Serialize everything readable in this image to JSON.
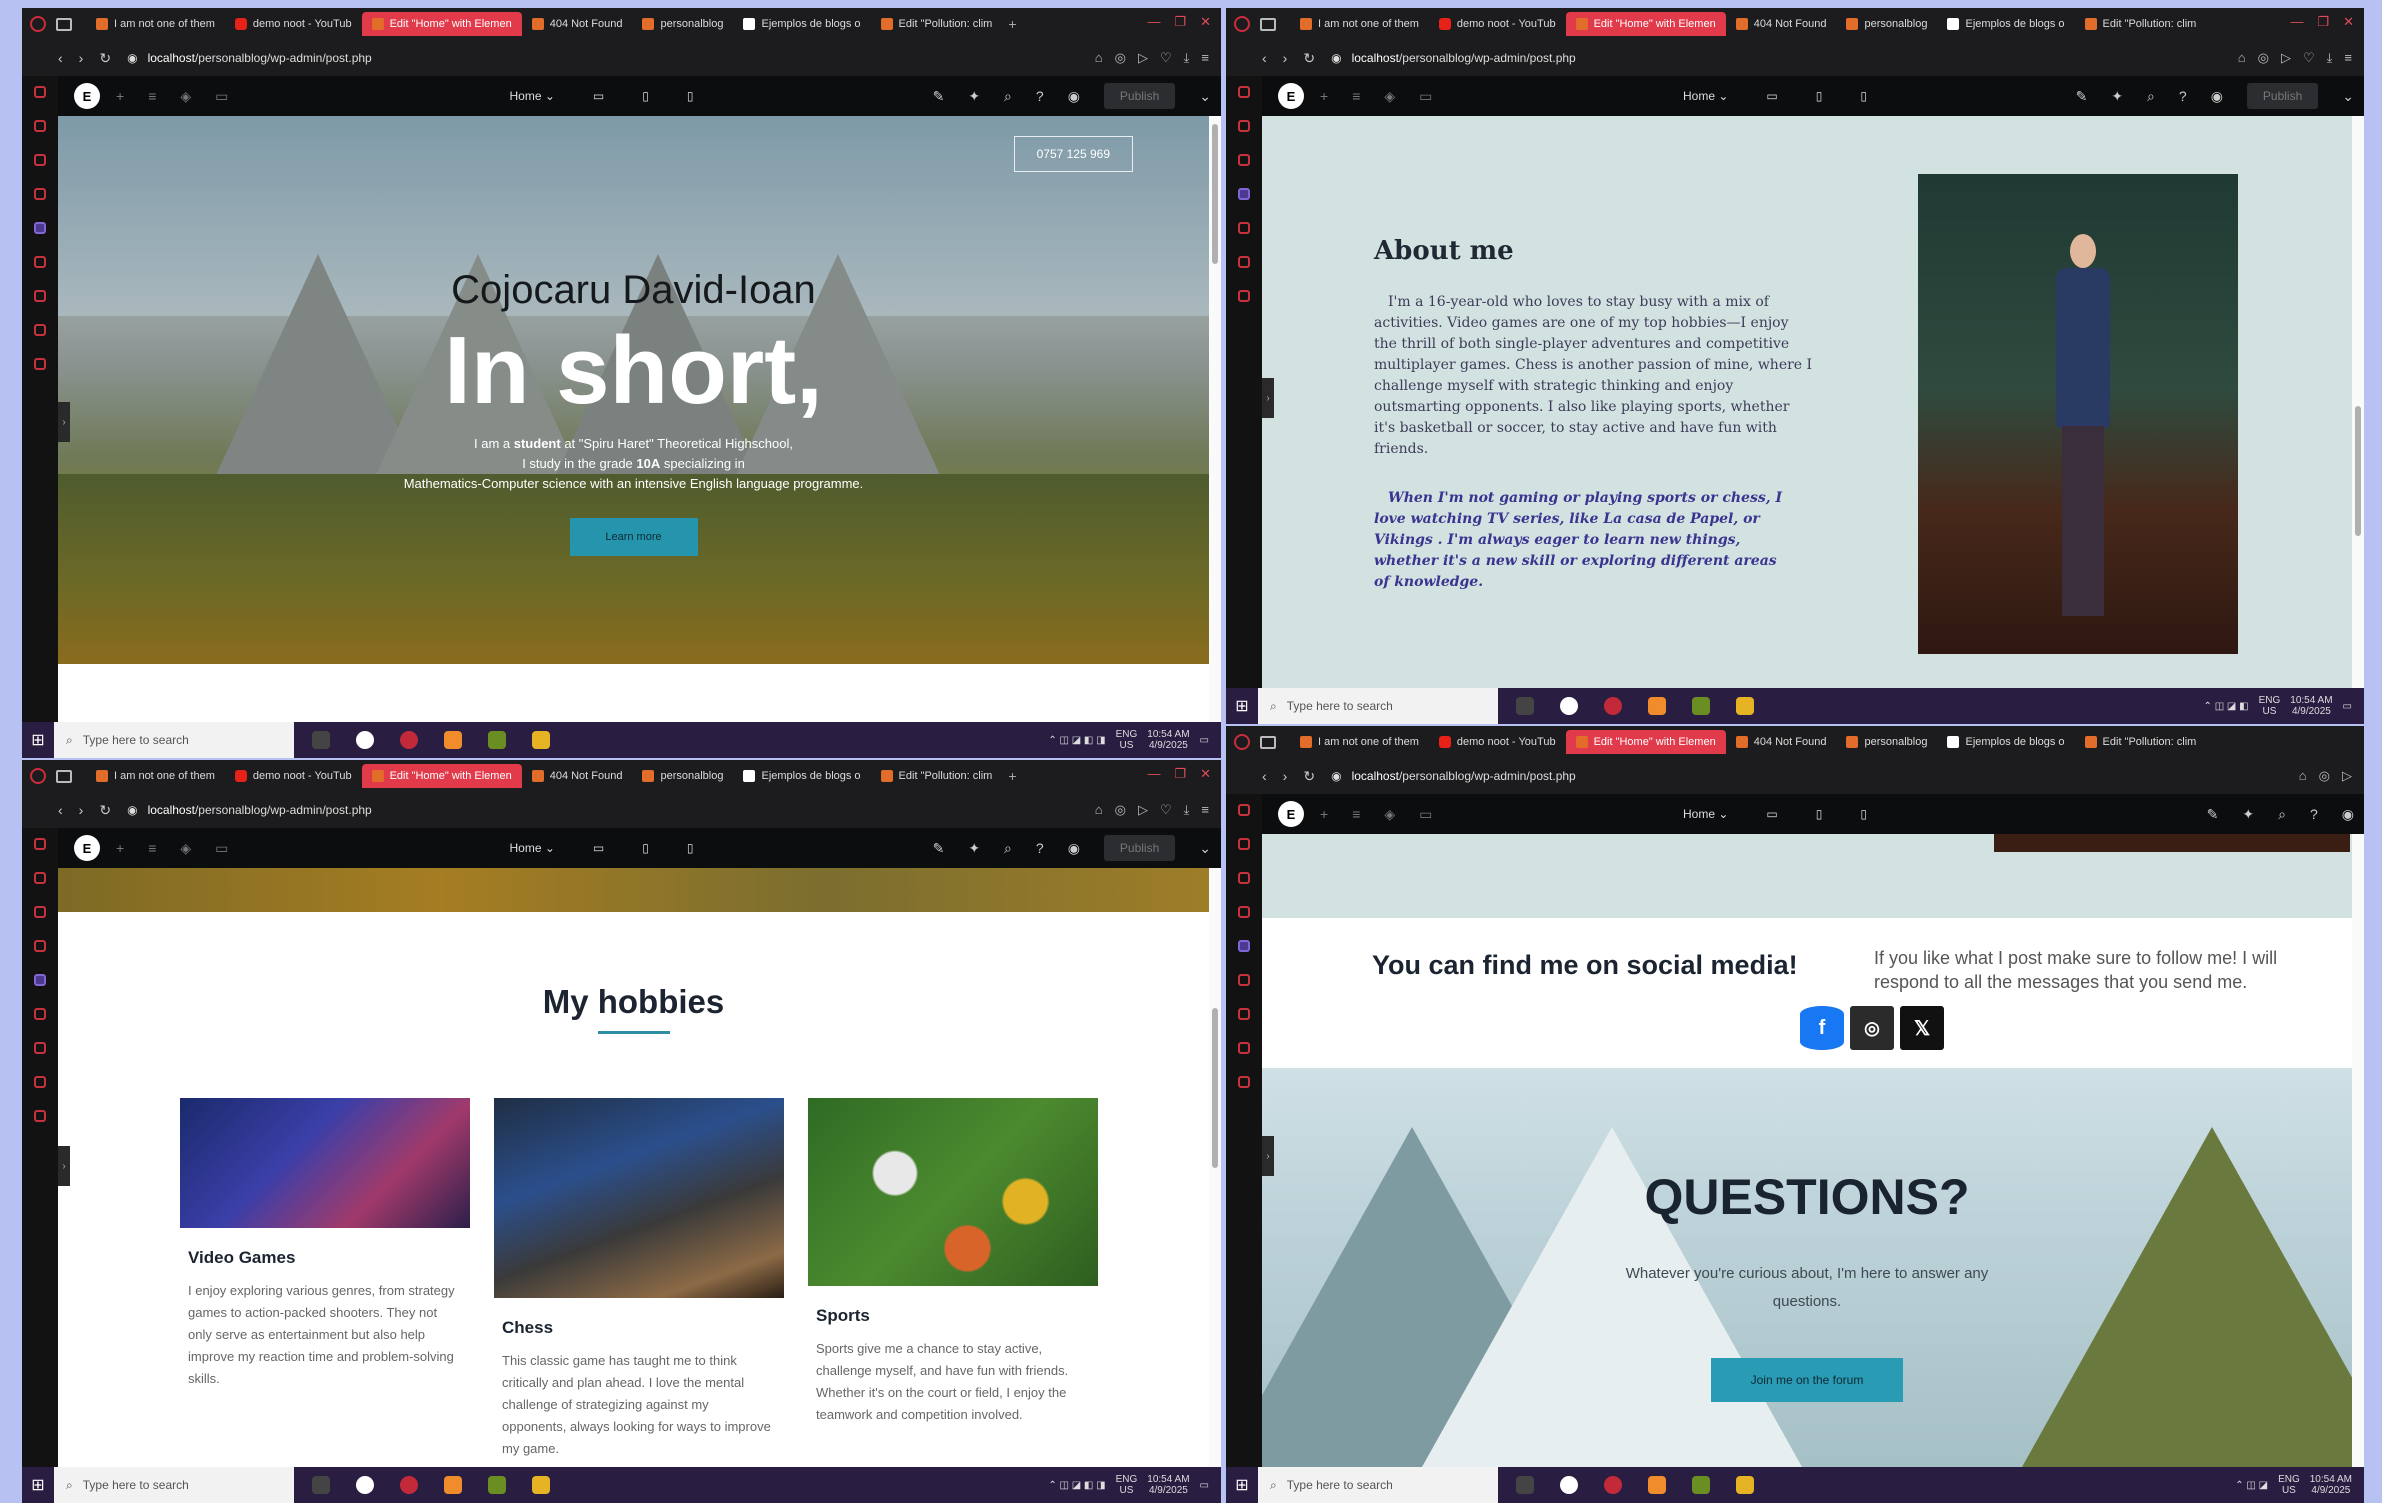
{
  "browser": {
    "tabs": [
      "I am not one of them",
      "demo noot - YouTub",
      "Edit \"Home\" with Elemen",
      "404 Not Found",
      "personalblog",
      "Ejemplos de blogs o",
      "Edit \"Pollution: clim"
    ],
    "url_host": "localhost",
    "url_path": "/personalblog/wp-admin/post.php"
  },
  "elementor": {
    "page_name": "Home",
    "publish_label": "Publish"
  },
  "taskbar": {
    "search_placeholder": "Type here to search",
    "lang": "ENG",
    "region": "US",
    "time": "10:54 AM",
    "date": "4/9/2025"
  },
  "hero": {
    "phone": "0757 125 969",
    "name": "Cojocaru David-Ioan",
    "headline": "In short,",
    "line1_pre": "I am a ",
    "line1_bold": "student",
    "line1_post": " at \"Spiru Haret\" Theoretical Highschool,",
    "line2_pre": "I study in the grade ",
    "line2_bold": "10A",
    "line2_post": " specializing in",
    "line3": "Mathematics-Computer science with an intensive English language programme.",
    "button": "Learn more"
  },
  "about": {
    "title": "About me",
    "p1": "I'm a 16-year-old who loves to stay busy with a mix of activities. Video games are one of my top hobbies—I enjoy the thrill of both single-player adventures and competitive multiplayer games. Chess is another passion of mine, where I challenge myself with strategic thinking and enjoy outsmarting opponents. I also like playing sports, whether it's basketball or soccer, to stay active and have fun with friends.",
    "p2": "When I'm not gaming or playing sports or chess, I love watching TV series, like La casa de Papel, or Vikings . I'm always eager to learn new things, whether it's a new skill or exploring different areas of knowledge."
  },
  "hobbies": {
    "title": "My hobbies",
    "cards": [
      {
        "title": "Video Games",
        "text": "I enjoy exploring various genres, from strategy games to action-packed shooters. They not only serve as entertainment but also help improve my reaction time and problem-solving skills."
      },
      {
        "title": "Chess",
        "text": "This classic game has taught me to think critically and plan ahead. I love the mental challenge of strategizing against my opponents, always looking for ways to improve my game."
      },
      {
        "title": "Sports",
        "text": "Sports give me a chance to stay active, challenge myself, and have fun with friends. Whether it's on the court or field, I enjoy the teamwork and competition involved."
      }
    ]
  },
  "social": {
    "title": "You can find me on social media!",
    "text": "If you like what I post make sure to follow me! I will respond to all the messages that you send me.",
    "icons": [
      "facebook-icon",
      "instagram-icon",
      "x-icon"
    ]
  },
  "questions": {
    "title": "QUESTIONS?",
    "text": "Whatever you're curious about, I'm here to answer any questions.",
    "button": "Join me on the forum"
  },
  "colors": {
    "accent": "#2595ad",
    "active_tab": "#e13a4b",
    "taskbar": "#2a1d42",
    "about_bg": "#d1e2e0",
    "facebook": "#1877f2",
    "instagram": "#2b2b2b",
    "x": "#111111"
  }
}
